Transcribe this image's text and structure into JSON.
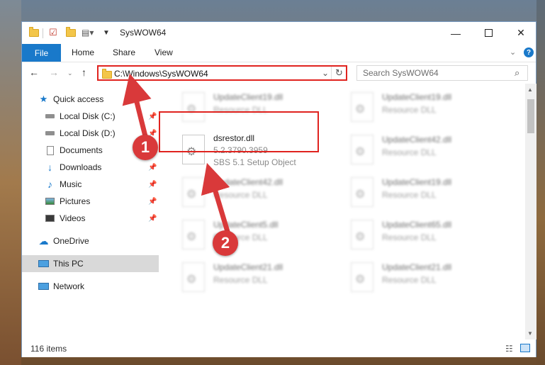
{
  "window": {
    "title": "SysWOW64"
  },
  "ribbon": {
    "tabs": [
      "File",
      "Home",
      "Share",
      "View"
    ]
  },
  "address": {
    "path": "C:\\Windows\\SysWOW64"
  },
  "search": {
    "placeholder": "Search SysWOW64"
  },
  "nav": {
    "items": [
      {
        "label": "Quick access",
        "icon": "star-icon"
      },
      {
        "label": "Local Disk (C:)",
        "icon": "drive-icon",
        "pinned": true
      },
      {
        "label": "Local Disk (D:)",
        "icon": "drive-icon",
        "pinned": true
      },
      {
        "label": "Documents",
        "icon": "document-icon",
        "pinned": true
      },
      {
        "label": "Downloads",
        "icon": "download-icon",
        "pinned": true
      },
      {
        "label": "Music",
        "icon": "music-icon",
        "pinned": true
      },
      {
        "label": "Pictures",
        "icon": "pictures-icon",
        "pinned": true
      },
      {
        "label": "Videos",
        "icon": "video-icon",
        "pinned": true
      },
      {
        "label": "OneDrive",
        "icon": "cloud-icon"
      },
      {
        "label": "This PC",
        "icon": "computer-icon",
        "selected": true
      },
      {
        "label": "Network",
        "icon": "network-icon"
      }
    ]
  },
  "files": [
    {
      "name": "UpdateClient19.dll",
      "desc": "Resource DLL"
    },
    {
      "name": "UpdateClient19.dll",
      "desc": "Resource DLL"
    },
    {
      "name": "dsrestor.dll",
      "version": "5.2.3790.3959",
      "desc": "SBS 5.1 Setup Object"
    },
    {
      "name": "UpdateClient42.dll",
      "desc": "Resource DLL"
    },
    {
      "name": "UpdateClient42.dll",
      "desc": "Resource DLL"
    },
    {
      "name": "UpdateClient19.dll",
      "desc": "Resource DLL"
    },
    {
      "name": "UpdateClient5.dll",
      "desc": "Resource DLL"
    },
    {
      "name": "UpdateClient65.dll",
      "desc": "Resource DLL"
    },
    {
      "name": "UpdateClient21.dll",
      "desc": "Resource DLL"
    },
    {
      "name": "UpdateClient21.dll",
      "desc": "Resource DLL"
    }
  ],
  "status": {
    "items": "116 items"
  },
  "annotations": {
    "badge1": "1",
    "badge2": "2"
  },
  "colors": {
    "accent": "#1979ca",
    "highlight": "#e0231f",
    "badge": "#d9393a"
  }
}
